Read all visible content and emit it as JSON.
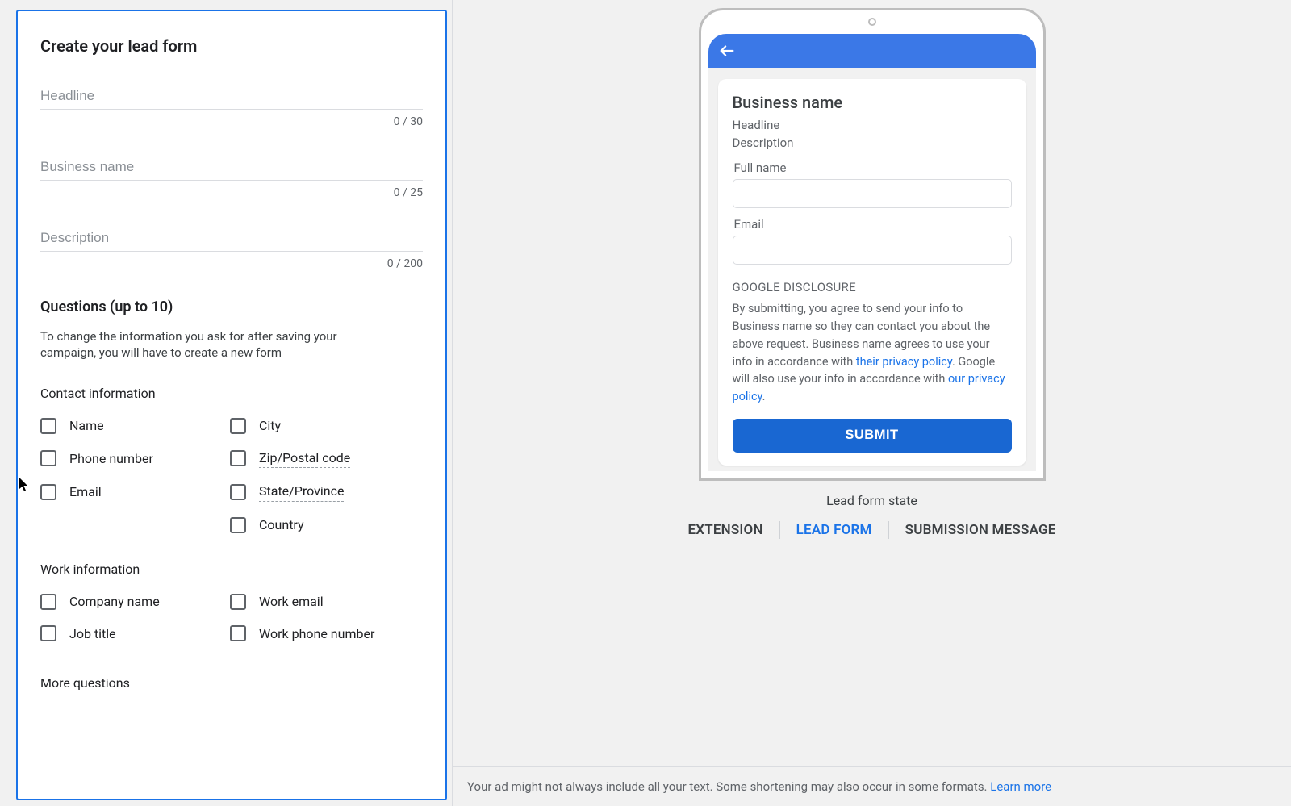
{
  "form": {
    "title": "Create your lead form",
    "fields": {
      "headline": {
        "placeholder": "Headline",
        "counter": "0 / 30"
      },
      "business": {
        "placeholder": "Business name",
        "counter": "0 / 25"
      },
      "description": {
        "placeholder": "Description",
        "counter": "0 / 200"
      }
    },
    "questions": {
      "title": "Questions (up to 10)",
      "desc": "To change the information you ask for after saving your campaign, you will have to create a new form"
    },
    "contact": {
      "title": "Contact information",
      "left": [
        "Name",
        "Phone number",
        "Email"
      ],
      "right": [
        "City",
        "Zip/Postal code",
        "State/Province",
        "Country"
      ]
    },
    "work": {
      "title": "Work information",
      "left": [
        "Company name",
        "Job title"
      ],
      "right": [
        "Work email",
        "Work phone number"
      ]
    },
    "more": "More questions"
  },
  "preview": {
    "business": "Business name",
    "headline": "Headline",
    "description": "Description",
    "fields": [
      "Full name",
      "Email"
    ],
    "disclosure_head": "GOOGLE DISCLOSURE",
    "disclosure_pre": "By submitting, you agree to send your info to Business name so they can contact you about the above request. Business name agrees to use your info in accordance with ",
    "link1": "their privacy policy",
    "disclosure_mid": ". Google will also use your info in accordance with ",
    "link2": "our privacy policy",
    "disclosure_post": ".",
    "submit": "SUBMIT",
    "label": "Lead form state",
    "tabs": [
      "EXTENSION",
      "LEAD FORM",
      "SUBMISSION MESSAGE"
    ]
  },
  "notice": {
    "text": "Your ad might not always include all your text. Some shortening may also occur in some formats. ",
    "link": "Learn more"
  }
}
